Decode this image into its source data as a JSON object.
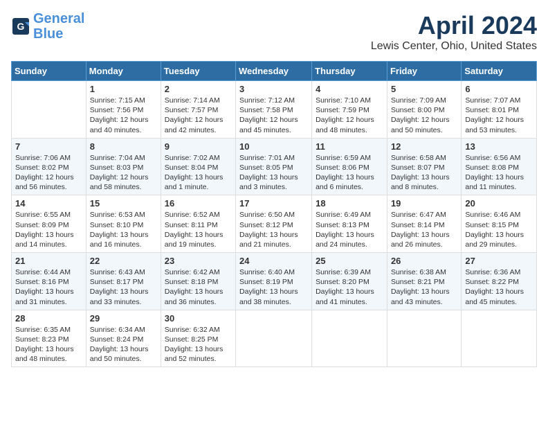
{
  "header": {
    "logo_line1": "General",
    "logo_line2": "Blue",
    "month": "April 2024",
    "location": "Lewis Center, Ohio, United States"
  },
  "weekdays": [
    "Sunday",
    "Monday",
    "Tuesday",
    "Wednesday",
    "Thursday",
    "Friday",
    "Saturday"
  ],
  "weeks": [
    [
      {
        "day": "",
        "content": ""
      },
      {
        "day": "1",
        "content": "Sunrise: 7:15 AM\nSunset: 7:56 PM\nDaylight: 12 hours\nand 40 minutes."
      },
      {
        "day": "2",
        "content": "Sunrise: 7:14 AM\nSunset: 7:57 PM\nDaylight: 12 hours\nand 42 minutes."
      },
      {
        "day": "3",
        "content": "Sunrise: 7:12 AM\nSunset: 7:58 PM\nDaylight: 12 hours\nand 45 minutes."
      },
      {
        "day": "4",
        "content": "Sunrise: 7:10 AM\nSunset: 7:59 PM\nDaylight: 12 hours\nand 48 minutes."
      },
      {
        "day": "5",
        "content": "Sunrise: 7:09 AM\nSunset: 8:00 PM\nDaylight: 12 hours\nand 50 minutes."
      },
      {
        "day": "6",
        "content": "Sunrise: 7:07 AM\nSunset: 8:01 PM\nDaylight: 12 hours\nand 53 minutes."
      }
    ],
    [
      {
        "day": "7",
        "content": "Sunrise: 7:06 AM\nSunset: 8:02 PM\nDaylight: 12 hours\nand 56 minutes."
      },
      {
        "day": "8",
        "content": "Sunrise: 7:04 AM\nSunset: 8:03 PM\nDaylight: 12 hours\nand 58 minutes."
      },
      {
        "day": "9",
        "content": "Sunrise: 7:02 AM\nSunset: 8:04 PM\nDaylight: 13 hours\nand 1 minute."
      },
      {
        "day": "10",
        "content": "Sunrise: 7:01 AM\nSunset: 8:05 PM\nDaylight: 13 hours\nand 3 minutes."
      },
      {
        "day": "11",
        "content": "Sunrise: 6:59 AM\nSunset: 8:06 PM\nDaylight: 13 hours\nand 6 minutes."
      },
      {
        "day": "12",
        "content": "Sunrise: 6:58 AM\nSunset: 8:07 PM\nDaylight: 13 hours\nand 8 minutes."
      },
      {
        "day": "13",
        "content": "Sunrise: 6:56 AM\nSunset: 8:08 PM\nDaylight: 13 hours\nand 11 minutes."
      }
    ],
    [
      {
        "day": "14",
        "content": "Sunrise: 6:55 AM\nSunset: 8:09 PM\nDaylight: 13 hours\nand 14 minutes."
      },
      {
        "day": "15",
        "content": "Sunrise: 6:53 AM\nSunset: 8:10 PM\nDaylight: 13 hours\nand 16 minutes."
      },
      {
        "day": "16",
        "content": "Sunrise: 6:52 AM\nSunset: 8:11 PM\nDaylight: 13 hours\nand 19 minutes."
      },
      {
        "day": "17",
        "content": "Sunrise: 6:50 AM\nSunset: 8:12 PM\nDaylight: 13 hours\nand 21 minutes."
      },
      {
        "day": "18",
        "content": "Sunrise: 6:49 AM\nSunset: 8:13 PM\nDaylight: 13 hours\nand 24 minutes."
      },
      {
        "day": "19",
        "content": "Sunrise: 6:47 AM\nSunset: 8:14 PM\nDaylight: 13 hours\nand 26 minutes."
      },
      {
        "day": "20",
        "content": "Sunrise: 6:46 AM\nSunset: 8:15 PM\nDaylight: 13 hours\nand 29 minutes."
      }
    ],
    [
      {
        "day": "21",
        "content": "Sunrise: 6:44 AM\nSunset: 8:16 PM\nDaylight: 13 hours\nand 31 minutes."
      },
      {
        "day": "22",
        "content": "Sunrise: 6:43 AM\nSunset: 8:17 PM\nDaylight: 13 hours\nand 33 minutes."
      },
      {
        "day": "23",
        "content": "Sunrise: 6:42 AM\nSunset: 8:18 PM\nDaylight: 13 hours\nand 36 minutes."
      },
      {
        "day": "24",
        "content": "Sunrise: 6:40 AM\nSunset: 8:19 PM\nDaylight: 13 hours\nand 38 minutes."
      },
      {
        "day": "25",
        "content": "Sunrise: 6:39 AM\nSunset: 8:20 PM\nDaylight: 13 hours\nand 41 minutes."
      },
      {
        "day": "26",
        "content": "Sunrise: 6:38 AM\nSunset: 8:21 PM\nDaylight: 13 hours\nand 43 minutes."
      },
      {
        "day": "27",
        "content": "Sunrise: 6:36 AM\nSunset: 8:22 PM\nDaylight: 13 hours\nand 45 minutes."
      }
    ],
    [
      {
        "day": "28",
        "content": "Sunrise: 6:35 AM\nSunset: 8:23 PM\nDaylight: 13 hours\nand 48 minutes."
      },
      {
        "day": "29",
        "content": "Sunrise: 6:34 AM\nSunset: 8:24 PM\nDaylight: 13 hours\nand 50 minutes."
      },
      {
        "day": "30",
        "content": "Sunrise: 6:32 AM\nSunset: 8:25 PM\nDaylight: 13 hours\nand 52 minutes."
      },
      {
        "day": "",
        "content": ""
      },
      {
        "day": "",
        "content": ""
      },
      {
        "day": "",
        "content": ""
      },
      {
        "day": "",
        "content": ""
      }
    ]
  ]
}
